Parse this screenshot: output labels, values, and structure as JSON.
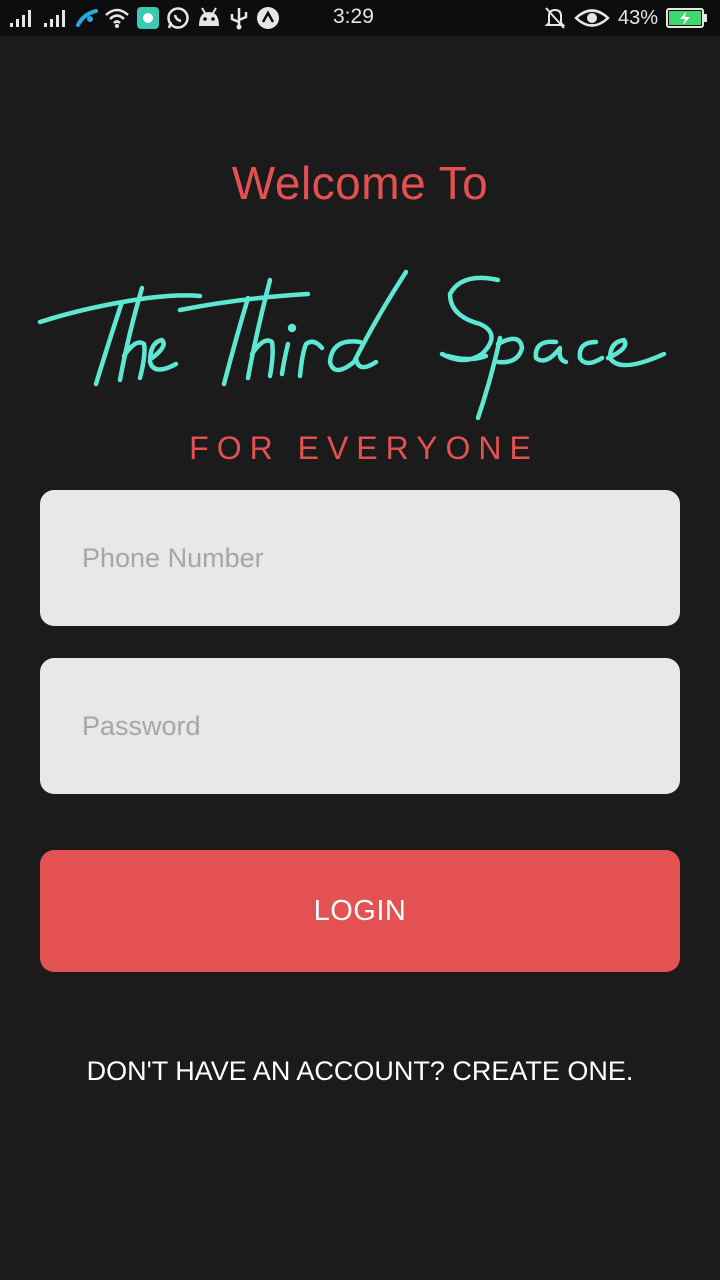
{
  "status_bar": {
    "time": "3:29",
    "battery_percent": "43%",
    "battery_level": 0.43,
    "icons_left": [
      "signal-icon",
      "signal-icon",
      "carrier-icon",
      "wifi-icon",
      "app-notification-icon",
      "whatsapp-icon",
      "android-icon",
      "usb-icon",
      "arrow-up-icon"
    ],
    "icons_right": [
      "bell-muted-icon",
      "eye-icon",
      "battery-icon"
    ]
  },
  "login": {
    "welcome": "Welcome To",
    "logo_text": "The Third Space",
    "tagline": "FOR EVERYONE",
    "phone_placeholder": "Phone Number",
    "password_placeholder": "Password",
    "login_label": "LOGIN",
    "signup_text": "DON'T HAVE AN ACCOUNT? CREATE ONE."
  },
  "colors": {
    "background": "#1b1b1b",
    "accent_red": "#e35152",
    "logo_teal": "#5ee8d3",
    "field_bg": "#e8e8e8"
  }
}
